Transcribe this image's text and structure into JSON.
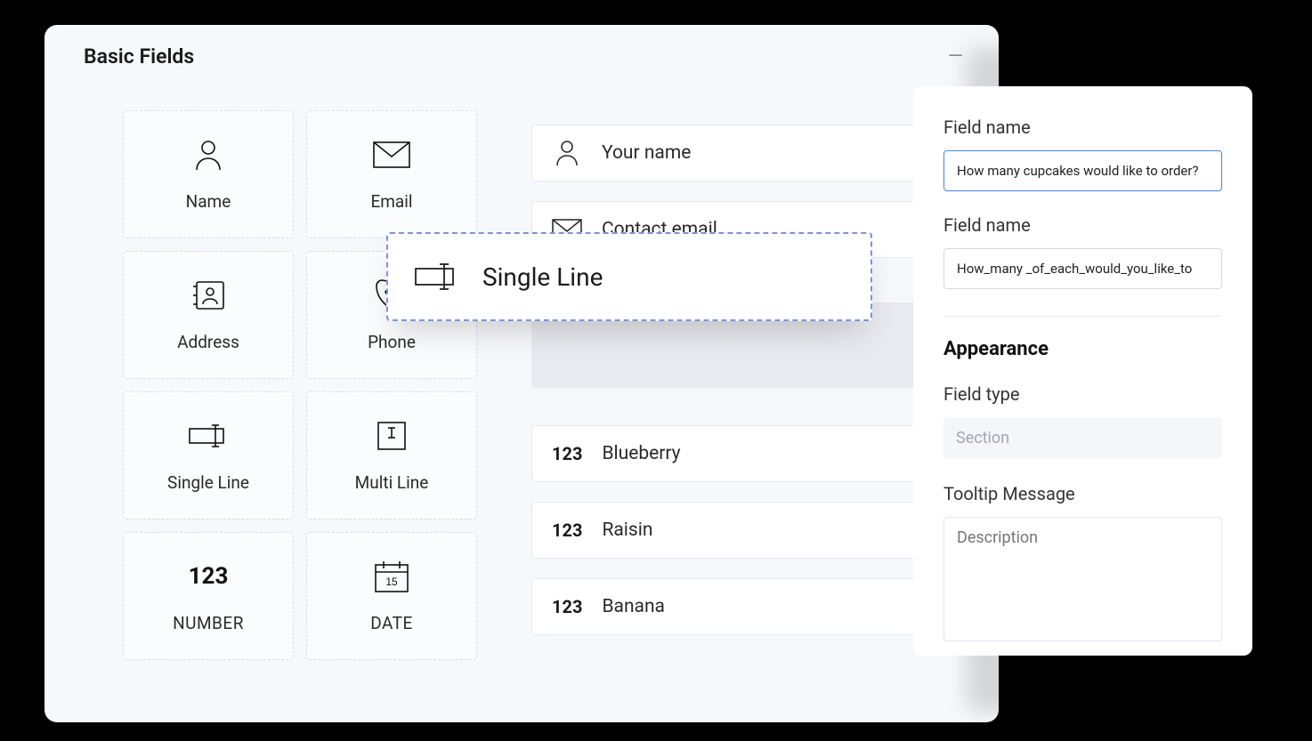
{
  "palette": {
    "title": "Basic Fields",
    "tiles": [
      {
        "key": "name",
        "label": "Name",
        "icon": "person-icon"
      },
      {
        "key": "email",
        "label": "Email",
        "icon": "envelope-icon"
      },
      {
        "key": "address",
        "label": "Address",
        "icon": "address-book-icon"
      },
      {
        "key": "phone",
        "label": "Phone",
        "icon": "phone-icon"
      },
      {
        "key": "singleline",
        "label": "Single Line",
        "icon": "text-field-icon"
      },
      {
        "key": "multiline",
        "label": "Multi Line",
        "icon": "text-area-icon"
      },
      {
        "key": "number",
        "label": "NUMBER",
        "icon": "number-icon"
      },
      {
        "key": "date",
        "label": "DATE",
        "icon": "calendar-icon"
      }
    ]
  },
  "form": {
    "rows": [
      {
        "icon": "person-icon",
        "label": "Your name"
      },
      {
        "icon": "envelope-icon",
        "label": "Contact email"
      }
    ],
    "number_rows": [
      {
        "prefix": "123",
        "label": "Blueberry"
      },
      {
        "prefix": "123",
        "label": "Raisin"
      },
      {
        "prefix": "123",
        "label": "Banana"
      }
    ]
  },
  "dragging": {
    "label": "Single Line"
  },
  "properties": {
    "field_name_label_1": "Field name",
    "field_name_value_1": "How many cupcakes would like to order?",
    "field_name_label_2": "Field name",
    "field_name_value_2": "How_many _of_each_would_you_like_to",
    "appearance_heading": "Appearance",
    "field_type_label": "Field type",
    "field_type_value": "Section",
    "tooltip_label": "Tooltip Message",
    "tooltip_placeholder": "Description"
  }
}
